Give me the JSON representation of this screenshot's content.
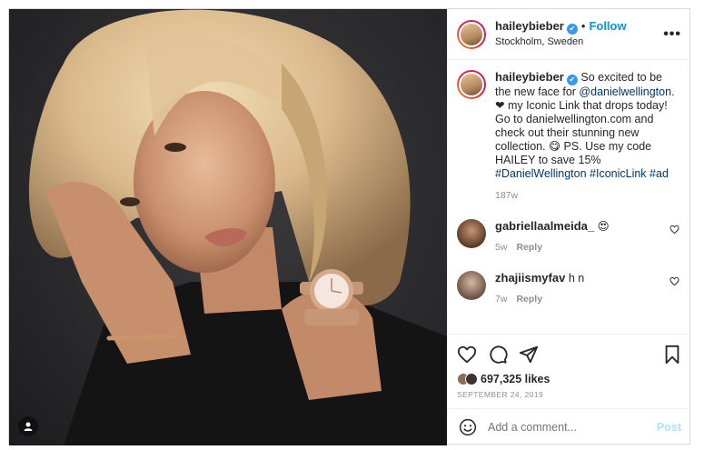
{
  "header": {
    "username": "haileybieber",
    "separator": "•",
    "follow_label": "Follow",
    "location": "Stockholm, Sweden",
    "more_label": "•••"
  },
  "caption": {
    "username": "haileybieber",
    "text_1": "So excited to be the new face for ",
    "mention": "@danielwellington",
    "text_2": ". ❤ my Iconic Link that drops today! Go to danielwellington.com and check out their stunning new collection. 😋 PS. Use my code HAILEY to save 15% ",
    "hashtag_1": "#DanielWellington",
    "hashtag_2": "#IconicLink",
    "hashtag_3": "#ad",
    "age": "187w"
  },
  "comments": [
    {
      "username": "gabriellaalmeida_",
      "text": "😍",
      "age": "5w",
      "reply_label": "Reply"
    },
    {
      "username": "zhajiismyfav",
      "text": "h n",
      "age": "7w",
      "reply_label": "Reply"
    }
  ],
  "engagement": {
    "likes": "697,325 likes",
    "date": "SEPTEMBER 24, 2019"
  },
  "add_comment": {
    "placeholder": "Add a comment...",
    "post_label": "Post"
  },
  "colors": {
    "link": "#0095f6",
    "tag": "#00376b",
    "muted": "#8e8e8e",
    "post_disabled": "#b2dffc",
    "verified": "#3897f0"
  },
  "icons": [
    "user-tag-icon",
    "verified-badge-icon",
    "more-options-icon",
    "heart-icon",
    "comment-icon",
    "share-icon",
    "save-bookmark-icon",
    "emoji-icon"
  ]
}
